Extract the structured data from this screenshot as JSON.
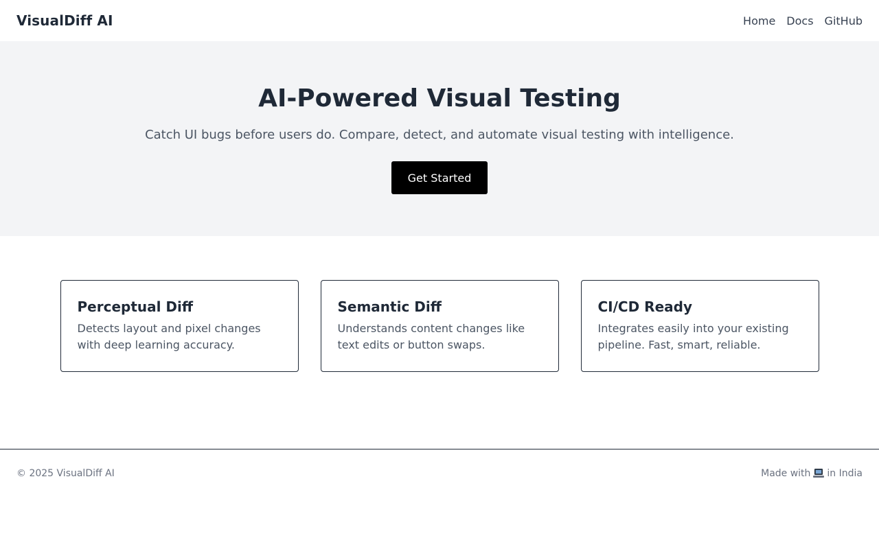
{
  "nav": {
    "brand": "VisualDiff AI",
    "links": [
      "Home",
      "Docs",
      "GitHub"
    ]
  },
  "hero": {
    "title": "AI-Powered Visual Testing",
    "subtitle": "Catch UI bugs before users do. Compare, detect, and automate visual testing with intelligence.",
    "cta_label": "Get Started"
  },
  "features": [
    {
      "title": "Perceptual Diff",
      "description": "Detects layout and pixel changes with deep learning accuracy."
    },
    {
      "title": "Semantic Diff",
      "description": "Understands content changes like text edits or button swaps."
    },
    {
      "title": "CI/CD Ready",
      "description": "Integrates easily into your existing pipeline. Fast, smart, reliable."
    }
  ],
  "footer": {
    "copyright": "© 2025 VisualDiff AI",
    "made_with_prefix": "Made with",
    "made_with_icon": "laptop-icon",
    "made_with_suffix": "in India"
  }
}
